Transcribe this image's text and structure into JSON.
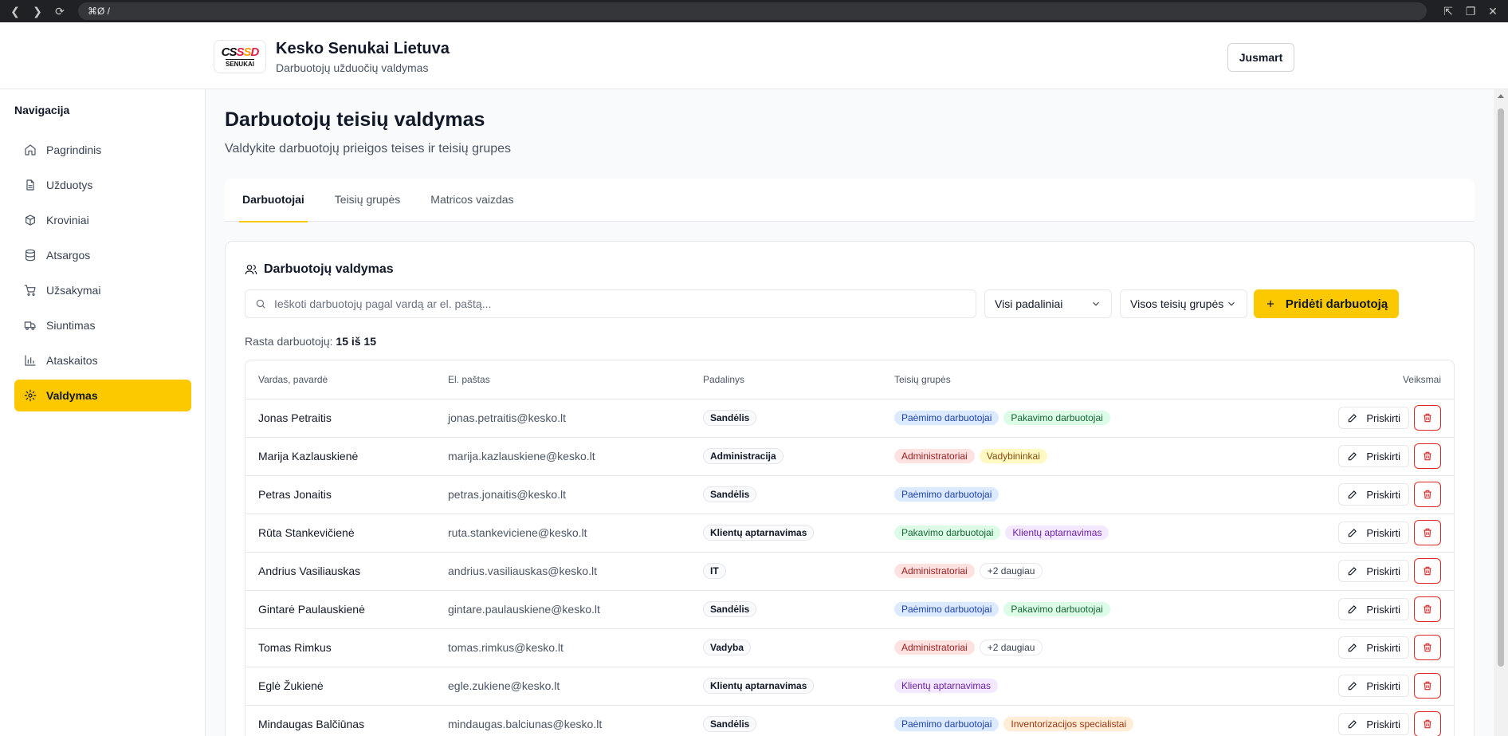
{
  "browser": {
    "address": "⌘Ø /"
  },
  "header": {
    "logo_text": "CSSSD",
    "logo_sub": "SENUKAI",
    "title": "Kesko Senukai Lietuva",
    "subtitle": "Darbuotojų užduočių valdymas",
    "user_button": "Jusmart"
  },
  "sidebar": {
    "heading": "Navigacija",
    "items": [
      {
        "label": "Pagrindinis",
        "icon": "home-icon"
      },
      {
        "label": "Užduotys",
        "icon": "file-icon"
      },
      {
        "label": "Kroviniai",
        "icon": "package-icon"
      },
      {
        "label": "Atsargos",
        "icon": "database-icon"
      },
      {
        "label": "Užsakymai",
        "icon": "cart-icon"
      },
      {
        "label": "Siuntimas",
        "icon": "truck-icon"
      },
      {
        "label": "Ataskaitos",
        "icon": "bar-chart-icon"
      },
      {
        "label": "Valdymas",
        "icon": "gear-icon",
        "active": true
      }
    ]
  },
  "page": {
    "title": "Darbuotojų teisių valdymas",
    "subtitle": "Valdykite darbuotojų prieigos teises ir teisių grupes",
    "tabs": [
      "Darbuotojai",
      "Teisių grupės",
      "Matricos vaizdas"
    ],
    "active_tab": 0
  },
  "panel": {
    "title": "Darbuotojų valdymas",
    "search_placeholder": "Ieškoti darbuotojų pagal vardą ar el. paštą...",
    "dept_filter": "Visi padaliniai",
    "group_filter": "Visos teisių grupės",
    "add_button": "Pridėti darbuotoją",
    "count_label": "Rasta darbuotojų: ",
    "count_value": "15 iš 15"
  },
  "table": {
    "columns": [
      "Vardas, pavardė",
      "El. paštas",
      "Padalinys",
      "Teisių grupės",
      "Veiksmai"
    ],
    "assign_label": "Priskirti",
    "rows": [
      {
        "name": "Jonas Petraitis",
        "email": "jonas.petraitis@kesko.lt",
        "dept": "Sandėlis",
        "groups": [
          [
            "Paėmimo darbuotojai",
            "blue"
          ],
          [
            "Pakavimo darbuotojai",
            "green"
          ]
        ]
      },
      {
        "name": "Marija Kazlauskienė",
        "email": "marija.kazlauskiene@kesko.lt",
        "dept": "Administracija",
        "groups": [
          [
            "Administratoriai",
            "red"
          ],
          [
            "Vadybininkai",
            "yellow"
          ]
        ]
      },
      {
        "name": "Petras Jonaitis",
        "email": "petras.jonaitis@kesko.lt",
        "dept": "Sandėlis",
        "groups": [
          [
            "Paėmimo darbuotojai",
            "blue"
          ]
        ]
      },
      {
        "name": "Rūta Stankevičienė",
        "email": "ruta.stankeviciene@kesko.lt",
        "dept": "Klientų aptarnavimas",
        "groups": [
          [
            "Pakavimo darbuotojai",
            "green"
          ],
          [
            "Klientų aptarnavimas",
            "purple"
          ]
        ]
      },
      {
        "name": "Andrius Vasiliauskas",
        "email": "andrius.vasiliauskas@kesko.lt",
        "dept": "IT",
        "groups": [
          [
            "Administratoriai",
            "red"
          ],
          [
            "+2 daugiau",
            "gray"
          ]
        ]
      },
      {
        "name": "Gintarė Paulauskienė",
        "email": "gintare.paulauskiene@kesko.lt",
        "dept": "Sandėlis",
        "groups": [
          [
            "Paėmimo darbuotojai",
            "blue"
          ],
          [
            "Pakavimo darbuotojai",
            "green"
          ]
        ]
      },
      {
        "name": "Tomas Rimkus",
        "email": "tomas.rimkus@kesko.lt",
        "dept": "Vadyba",
        "groups": [
          [
            "Administratoriai",
            "red"
          ],
          [
            "+2 daugiau",
            "gray"
          ]
        ]
      },
      {
        "name": "Eglė Žukienė",
        "email": "egle.zukiene@kesko.lt",
        "dept": "Klientų aptarnavimas",
        "groups": [
          [
            "Klientų aptarnavimas",
            "purple"
          ]
        ]
      },
      {
        "name": "Mindaugas Balčiūnas",
        "email": "mindaugas.balciunas@kesko.lt",
        "dept": "Sandėlis",
        "groups": [
          [
            "Paėmimo darbuotojai",
            "blue"
          ],
          [
            "Inventorizacijos specialistai",
            "orange"
          ]
        ]
      }
    ]
  },
  "colors": {
    "accent": "#fcc800",
    "danger": "#dc2626"
  }
}
